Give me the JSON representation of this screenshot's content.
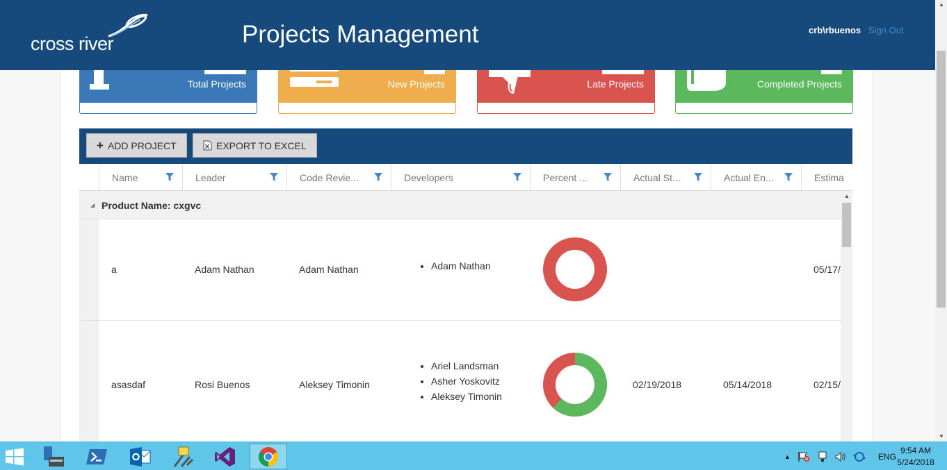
{
  "header": {
    "logo_text": "cross river",
    "title": "Projects Management",
    "user": "crb\\rbuenos",
    "signout": "Sign Out"
  },
  "cards": [
    {
      "label": "Total Projects",
      "color": "#3a78b8"
    },
    {
      "label": "New Projects",
      "color": "#efad4d"
    },
    {
      "label": "Late Projects",
      "color": "#d9534f"
    },
    {
      "label": "Completed Projects",
      "color": "#5cb85c"
    }
  ],
  "toolbar": {
    "add_label": "ADD PROJECT",
    "export_label": "EXPORT TO EXCEL"
  },
  "columns": [
    "Name",
    "Leader",
    "Code Revie...",
    "Developers",
    "Percent ...",
    "Actual St...",
    "Actual En...",
    "Estima"
  ],
  "group": {
    "label": "Product Name: cxgvc"
  },
  "rows": [
    {
      "name": "a",
      "leader": "Adam Nathan",
      "code_reviewer": "Adam Nathan",
      "developers": [
        "Adam Nathan"
      ],
      "percent_complete": 0,
      "actual_start": "",
      "actual_end": "",
      "estimated": "05/17/"
    },
    {
      "name": "asasdaf",
      "leader": "Rosi Buenos",
      "code_reviewer": "Aleksey Timonin",
      "developers": [
        "Ariel Landsman",
        "Asher Yoskovitz",
        "Aleksey Timonin"
      ],
      "percent_complete": 0.62,
      "actual_start": "02/19/2018",
      "actual_end": "05/14/2018",
      "estimated": "02/15/"
    }
  ],
  "colors": {
    "header_bg": "#174a7c",
    "donut_remaining": "#d9534f",
    "donut_done": "#5cb85c",
    "link": "#3c8dd3"
  },
  "taskbar": {
    "icons": [
      "windows-start-icon",
      "server-manager-icon",
      "powershell-icon",
      "outlook-icon",
      "tools-icon",
      "visual-studio-icon",
      "chrome-icon"
    ],
    "lang": "ENG",
    "time": "9:54 AM",
    "date": "5/24/2018"
  }
}
